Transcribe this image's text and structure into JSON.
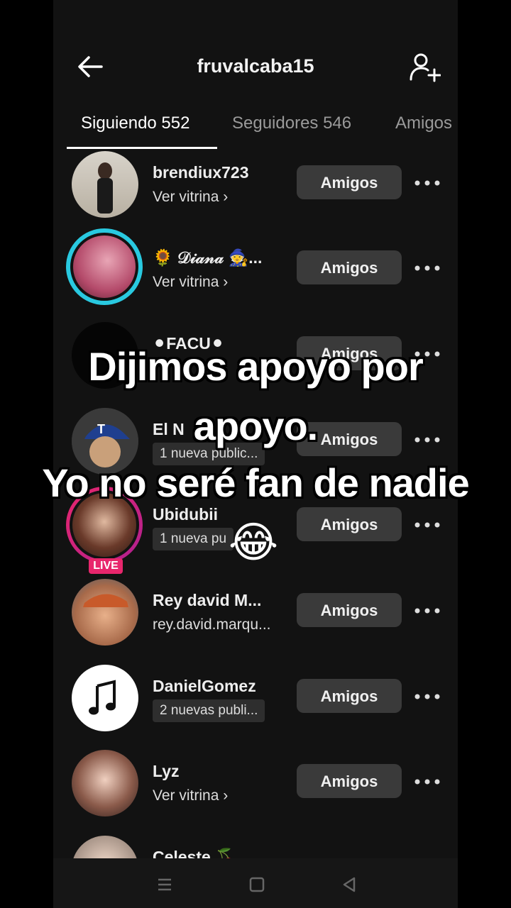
{
  "header": {
    "title": "fruvalcaba15",
    "back_icon": "arrow-left-icon",
    "add_icon": "add-user-icon"
  },
  "tabs": [
    {
      "label": "Siguiendo 552",
      "active": true
    },
    {
      "label": "Seguidores 546",
      "active": false
    },
    {
      "label": "Amigos",
      "active": false
    }
  ],
  "users": [
    {
      "name": "brendiux723",
      "sub": "Ver vitrina ›",
      "sub_type": "text",
      "button": "Amigos",
      "live": false
    },
    {
      "name": "🌻 𝒟𝒾𝒶𝓃𝒶 🧙...",
      "sub": "Ver vitrina ›",
      "sub_type": "text",
      "button": "Amigos",
      "live": false
    },
    {
      "name": "⚫FACU⚫",
      "sub": "",
      "sub_type": "text",
      "button": "Amigos",
      "live": false
    },
    {
      "name": "El N",
      "sub": "1 nueva public...",
      "sub_type": "pill",
      "button": "Amigos",
      "live": false
    },
    {
      "name": "Ubidubii",
      "sub": "1 nueva pu",
      "sub_type": "pill",
      "button": "Amigos",
      "live": true,
      "live_label": "LIVE"
    },
    {
      "name": "Rey david M...",
      "sub": "rey.david.marqu...",
      "sub_type": "text",
      "button": "Amigos",
      "live": false
    },
    {
      "name": "DanielGomez",
      "sub": "2 nuevas publi...",
      "sub_type": "pill",
      "button": "Amigos",
      "live": false
    },
    {
      "name": "Lyz",
      "sub": "Ver vitrina ›",
      "sub_type": "text",
      "button": "Amigos",
      "live": false
    },
    {
      "name": "Celeste 🍒",
      "sub": "",
      "sub_type": "text",
      "button": "",
      "live": false
    }
  ],
  "overlay": {
    "line1": "Dijimos apoyo por",
    "line2": "apoyo.",
    "line3": "Yo no seré fan de nadie",
    "emoji": "😂"
  },
  "colors": {
    "background": "#121212",
    "button": "#3a3a3a",
    "live": "#e8266c",
    "story_ring": "#29c9e0"
  }
}
